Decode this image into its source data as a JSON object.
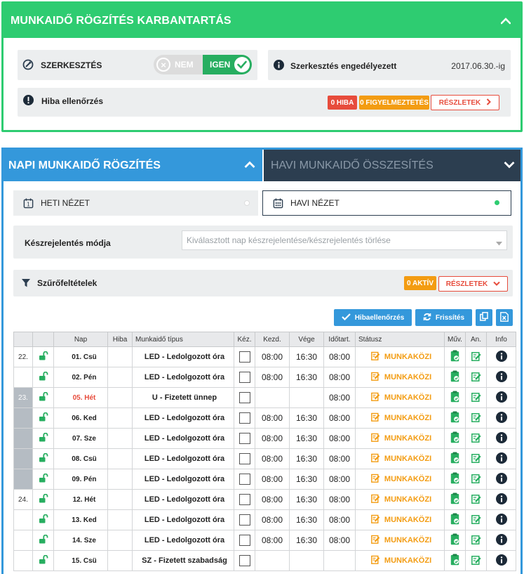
{
  "top": {
    "title": "MUNKAIDŐ RÖGZÍTÉS KARBANTARTÁS",
    "edit_label": "SZERKESZTÉS",
    "toggle_no": "NEM",
    "toggle_yes": "IGEN",
    "edit_status_label": "Szerkesztés engedélyezett",
    "edit_until": "2017.06.30.-ig",
    "error_check_label": "Hiba ellenőrzés",
    "error_badge": "0 HIBA",
    "warning_badge": "0 FIGYELMEZTETÉS",
    "details_button": "RÉSZLETEK"
  },
  "tabs": {
    "daily": "NAPI MUNKAIDŐ RÖGZÍTÉS",
    "monthly": "HAVI MUNKAIDŐ ÖSSZESÍTÉS"
  },
  "views": {
    "weekly": "HETI NÉZET",
    "monthly": "HAVI NÉZET"
  },
  "completion": {
    "label": "Készrejelentés módja",
    "placeholder": "Kiválasztott nap készrejelentése/készrejelentés törlése"
  },
  "filters": {
    "label": "Szűrőfeltételek",
    "active_badge": "0 AKTÍV",
    "details_button": "RÉSZLETEK"
  },
  "actions": {
    "error_check": "Hibaellenőrzés",
    "refresh": "Frissítés"
  },
  "colors": {
    "green": "#2ecc71",
    "blue": "#3498db",
    "dark": "#2c3e50",
    "status_orange": "#f39c12",
    "red": "#e74c3c"
  },
  "table": {
    "headers": [
      "",
      "",
      "Nap",
      "Hiba",
      "Munkaidő típus",
      "Kéz.",
      "Kezd.",
      "Vége",
      "Időtart.",
      "Státusz",
      "Műv.",
      "An.",
      "Info"
    ],
    "rows": [
      {
        "week": "22.",
        "day": "01. Csü",
        "type": "LED - Ledolgozott óra",
        "start": "08:00",
        "end": "16:30",
        "dur": "08:00",
        "status": "MUNKAKÖZI"
      },
      {
        "week": "",
        "day": "02. Pén",
        "type": "LED - Ledolgozott óra",
        "start": "08:00",
        "end": "16:30",
        "dur": "08:00",
        "status": "MUNKAKÖZI"
      },
      {
        "week": "23.",
        "day": "05. Hét",
        "type": "U - Fizetett ünnep",
        "start": "",
        "end": "",
        "dur": "08:00",
        "status": "MUNKAKÖZI"
      },
      {
        "week": "",
        "day": "06. Ked",
        "type": "LED - Ledolgozott óra",
        "start": "08:00",
        "end": "16:30",
        "dur": "08:00",
        "status": "MUNKAKÖZI"
      },
      {
        "week": "",
        "day": "07. Sze",
        "type": "LED - Ledolgozott óra",
        "start": "08:00",
        "end": "16:30",
        "dur": "08:00",
        "status": "MUNKAKÖZI"
      },
      {
        "week": "",
        "day": "08. Csü",
        "type": "LED - Ledolgozott óra",
        "start": "08:00",
        "end": "16:30",
        "dur": "08:00",
        "status": "MUNKAKÖZI"
      },
      {
        "week": "",
        "day": "09. Pén",
        "type": "LED - Ledolgozott óra",
        "start": "08:00",
        "end": "16:30",
        "dur": "08:00",
        "status": "MUNKAKÖZI"
      },
      {
        "week": "24.",
        "day": "12. Hét",
        "type": "LED - Ledolgozott óra",
        "start": "08:00",
        "end": "16:30",
        "dur": "08:00",
        "status": "MUNKAKÖZI"
      },
      {
        "week": "",
        "day": "13. Ked",
        "type": "LED - Ledolgozott óra",
        "start": "08:00",
        "end": "16:30",
        "dur": "08:00",
        "status": "MUNKAKÖZI"
      },
      {
        "week": "",
        "day": "14. Sze",
        "type": "LED - Ledolgozott óra",
        "start": "08:00",
        "end": "16:30",
        "dur": "08:00",
        "status": "MUNKAKÖZI"
      },
      {
        "week": "",
        "day": "15. Csü",
        "type": "SZ - Fizetett szabadság",
        "start": "",
        "end": "",
        "dur": "",
        "status": "MUNKAKÖZI"
      }
    ]
  }
}
